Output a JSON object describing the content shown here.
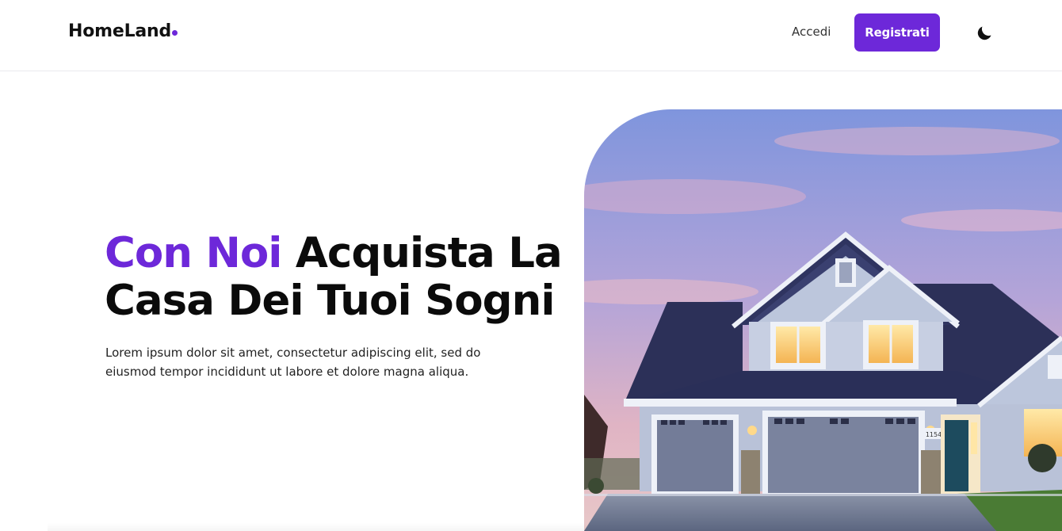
{
  "brand": {
    "name": "HomeLand",
    "accent_color": "#6d28d9"
  },
  "nav": {
    "login_label": "Accedi",
    "register_label": "Registrati",
    "theme_icon": "moon-icon"
  },
  "hero": {
    "title_accent": "Con Noi",
    "title_rest": "Acquista La Casa Dei Tuoi Sogni",
    "description": "Lorem ipsum dolor sit amet, consectetur adipiscing elit, sed do eiusmod tempor incididunt ut labore et dolore magna aliqua.",
    "image_subject": "house-photo",
    "house_number": "1154"
  }
}
